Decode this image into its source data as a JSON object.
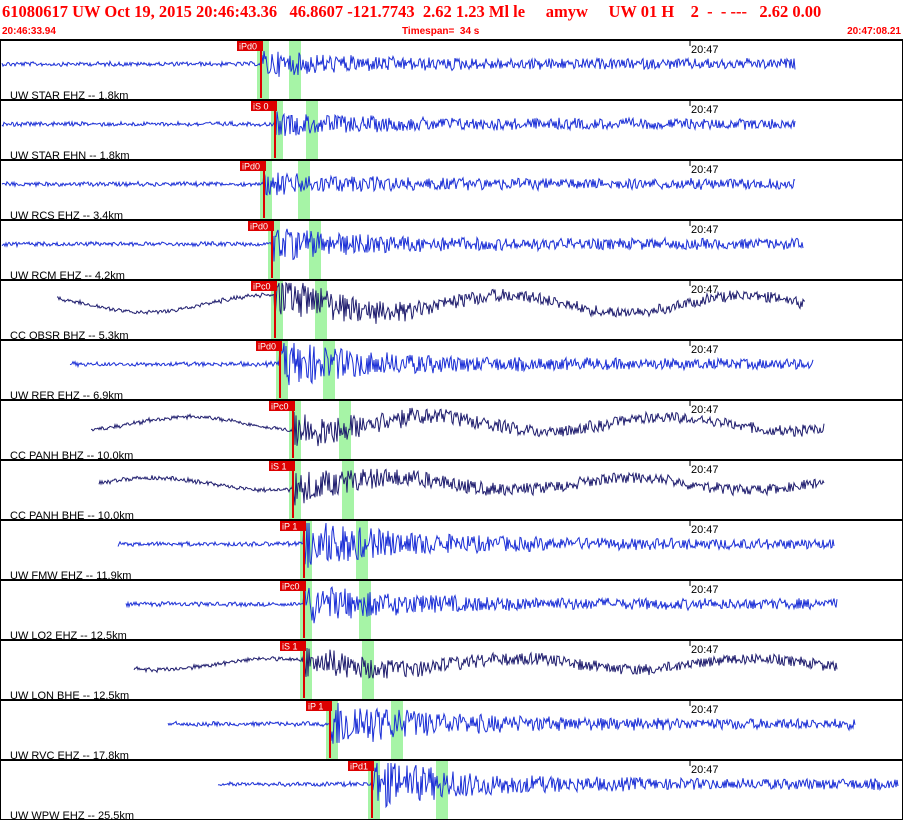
{
  "header": {
    "title": "61080617 UW Oct 19, 2015 20:46:43.36   46.8607 -121.7743  2.62 1.23 Ml le     amyw     UW 01 H    2  -  - ---   2.62 0.00",
    "start_time": "20:46:33.94",
    "timespan": "Timespan=  34 s",
    "end_time": "20:47:08.21"
  },
  "colors": {
    "header_text": "#ff0000",
    "trace_blue": "#1b2fd6",
    "trace_navy": "#1f1d6e",
    "pick_red": "#dd0000",
    "phase_window_green": "#a6f4a6",
    "divider": "#000000"
  },
  "chart_data": {
    "type": "line",
    "title": "61080617 UW Oct 19, 2015 20:46:43.36",
    "x_unit": "time",
    "xlim": [
      "20:46:33.94",
      "20:47:08.21"
    ],
    "minute_mark": "20:47",
    "series": [
      {
        "name": "UW STAR EHZ -- 1.8km",
        "pick": "iPd0",
        "color": "blue",
        "p_time_s": 9.9,
        "end_s": 30.1,
        "amp": 0.4
      },
      {
        "name": "UW STAR EHN -- 1.8km",
        "pick": "iS 0",
        "color": "blue",
        "p_time_s": 10.4,
        "end_s": 30.1,
        "amp": 0.35
      },
      {
        "name": "UW RCS EHZ -- 3.4km",
        "pick": "iPd0",
        "color": "blue",
        "p_time_s": 10.0,
        "end_s": 30.1,
        "amp": 0.35
      },
      {
        "name": "UW RCM EHZ -- 4.2km",
        "pick": "iPd0",
        "color": "blue",
        "p_time_s": 10.3,
        "end_s": 30.4,
        "amp": 0.6
      },
      {
        "name": "CC OBSR BHZ -- 5.3km",
        "pick": "iPc0",
        "color": "navy",
        "p_time_s": 10.4,
        "end_s": 30.5,
        "amp": 0.85
      },
      {
        "name": "UW RER EHZ -- 6.9km",
        "pick": "iPd0",
        "color": "blue",
        "p_time_s": 10.6,
        "end_s": 30.8,
        "amp": 0.95
      },
      {
        "name": "CC PANH BHZ -- 10.0km",
        "pick": "iPc0",
        "color": "navy",
        "p_time_s": 11.1,
        "end_s": 31.2,
        "amp": 0.7
      },
      {
        "name": "CC PANH BHE -- 10.0km",
        "pick": "iS 1",
        "color": "navy",
        "p_time_s": 11.1,
        "end_s": 31.2,
        "amp": 0.6
      },
      {
        "name": "UW FMW EHZ -- 11.9km",
        "pick": "iP 1",
        "color": "blue",
        "p_time_s": 11.5,
        "end_s": 31.6,
        "amp": 1.0
      },
      {
        "name": "UW LO2 EHZ -- 12.5km",
        "pick": "iPc0",
        "color": "blue",
        "p_time_s": 11.5,
        "end_s": 31.7,
        "amp": 0.75
      },
      {
        "name": "UW LON BHE -- 12.5km",
        "pick": "iS 1",
        "color": "navy",
        "p_time_s": 11.5,
        "end_s": 31.7,
        "amp": 0.55
      },
      {
        "name": "UW RVC EHZ -- 17.8km",
        "pick": "iP 1",
        "color": "blue",
        "p_time_s": 12.5,
        "end_s": 32.4,
        "amp": 1.0
      },
      {
        "name": "UW WPW EHZ -- 25.5km",
        "pick": "iPd1",
        "color": "blue",
        "p_time_s": 14.1,
        "end_s": 34.0,
        "amp": 1.0
      }
    ]
  }
}
